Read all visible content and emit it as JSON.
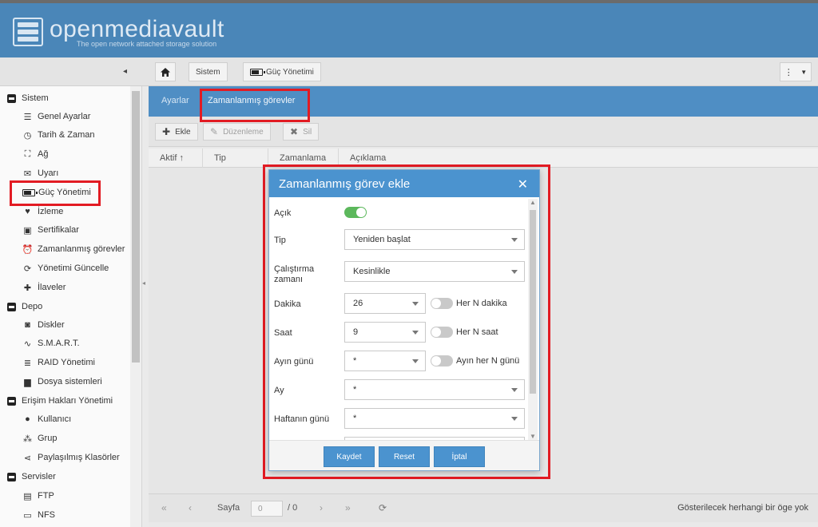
{
  "app": {
    "title": "openmediavault",
    "subtitle": "The open network attached storage solution"
  },
  "toolbar": {
    "collapse": "◂",
    "breadcrumbs": [
      {
        "label": "Sistem"
      },
      {
        "label": "Güç Yönetimi"
      }
    ]
  },
  "sidebar": {
    "groups": [
      {
        "label": "Sistem",
        "items": [
          {
            "label": "Genel Ayarlar",
            "icon": "sliders-icon"
          },
          {
            "label": "Tarih & Zaman",
            "icon": "clock-icon"
          },
          {
            "label": "Ağ",
            "icon": "network-icon"
          },
          {
            "label": "Uyarı",
            "icon": "envelope-icon"
          },
          {
            "label": "Güç Yönetimi",
            "icon": "battery-icon"
          },
          {
            "label": "İzleme",
            "icon": "heartbeat-icon"
          },
          {
            "label": "Sertifikalar",
            "icon": "certificate-icon"
          },
          {
            "label": "Zamanlanmış görevler",
            "icon": "alarm-clock-icon"
          },
          {
            "label": "Yönetimi Güncelle",
            "icon": "refresh-icon"
          },
          {
            "label": "İlaveler",
            "icon": "puzzle-icon"
          }
        ]
      },
      {
        "label": "Depo",
        "items": [
          {
            "label": "Diskler",
            "icon": "disk-icon"
          },
          {
            "label": "S.M.A.R.T.",
            "icon": "pulse-icon"
          },
          {
            "label": "RAID Yönetimi",
            "icon": "database-icon"
          },
          {
            "label": "Dosya sistemleri",
            "icon": "folder-icon"
          }
        ]
      },
      {
        "label": "Erişim Hakları Yönetimi",
        "items": [
          {
            "label": "Kullanıcı",
            "icon": "user-icon"
          },
          {
            "label": "Grup",
            "icon": "users-icon"
          },
          {
            "label": "Paylaşılmış Klasörler",
            "icon": "share-icon"
          }
        ]
      },
      {
        "label": "Servisler",
        "items": [
          {
            "label": "FTP",
            "icon": "ftp-icon"
          },
          {
            "label": "NFS",
            "icon": "nfs-icon"
          }
        ]
      }
    ]
  },
  "main": {
    "tabs": [
      {
        "label": "Ayarlar"
      },
      {
        "label": "Zamanlanmış görevler"
      }
    ],
    "actions": {
      "add": "Ekle",
      "edit": "Düzenleme",
      "delete": "Sil"
    },
    "columns": [
      {
        "label": "Aktif ↑"
      },
      {
        "label": "Tip"
      },
      {
        "label": "Zamanlama"
      },
      {
        "label": "Açıklama"
      }
    ],
    "pager": {
      "page_label": "Sayfa",
      "page_value": "0",
      "of": "/ 0",
      "empty_message": "Gösterilecek herhangi bir öge yok"
    }
  },
  "dialog": {
    "title": "Zamanlanmış görev ekle",
    "fields": {
      "enabled": {
        "label": "Açık"
      },
      "type": {
        "label": "Tip",
        "value": "Yeniden başlat"
      },
      "execution": {
        "label": "Çalıştırma zamanı",
        "value": "Kesinlikle"
      },
      "minute": {
        "label": "Dakika",
        "value": "26",
        "toggle_label": "Her N dakika"
      },
      "hour": {
        "label": "Saat",
        "value": "9",
        "toggle_label": "Her N saat"
      },
      "day_of_month": {
        "label": "Ayın günü",
        "value": "*",
        "toggle_label": "Ayın her N günü"
      },
      "month": {
        "label": "Ay",
        "value": "*"
      },
      "day_of_week": {
        "label": "Haftanın günü",
        "value": "*"
      }
    },
    "buttons": {
      "save": "Kaydet",
      "reset": "Reset",
      "cancel": "İptal"
    }
  },
  "colors": {
    "header": "#4a86b8",
    "tabbar": "#4f8ec4",
    "dialog_title": "#4b93cf",
    "highlight": "#e21b23",
    "toggle_on": "#5cb85c"
  }
}
